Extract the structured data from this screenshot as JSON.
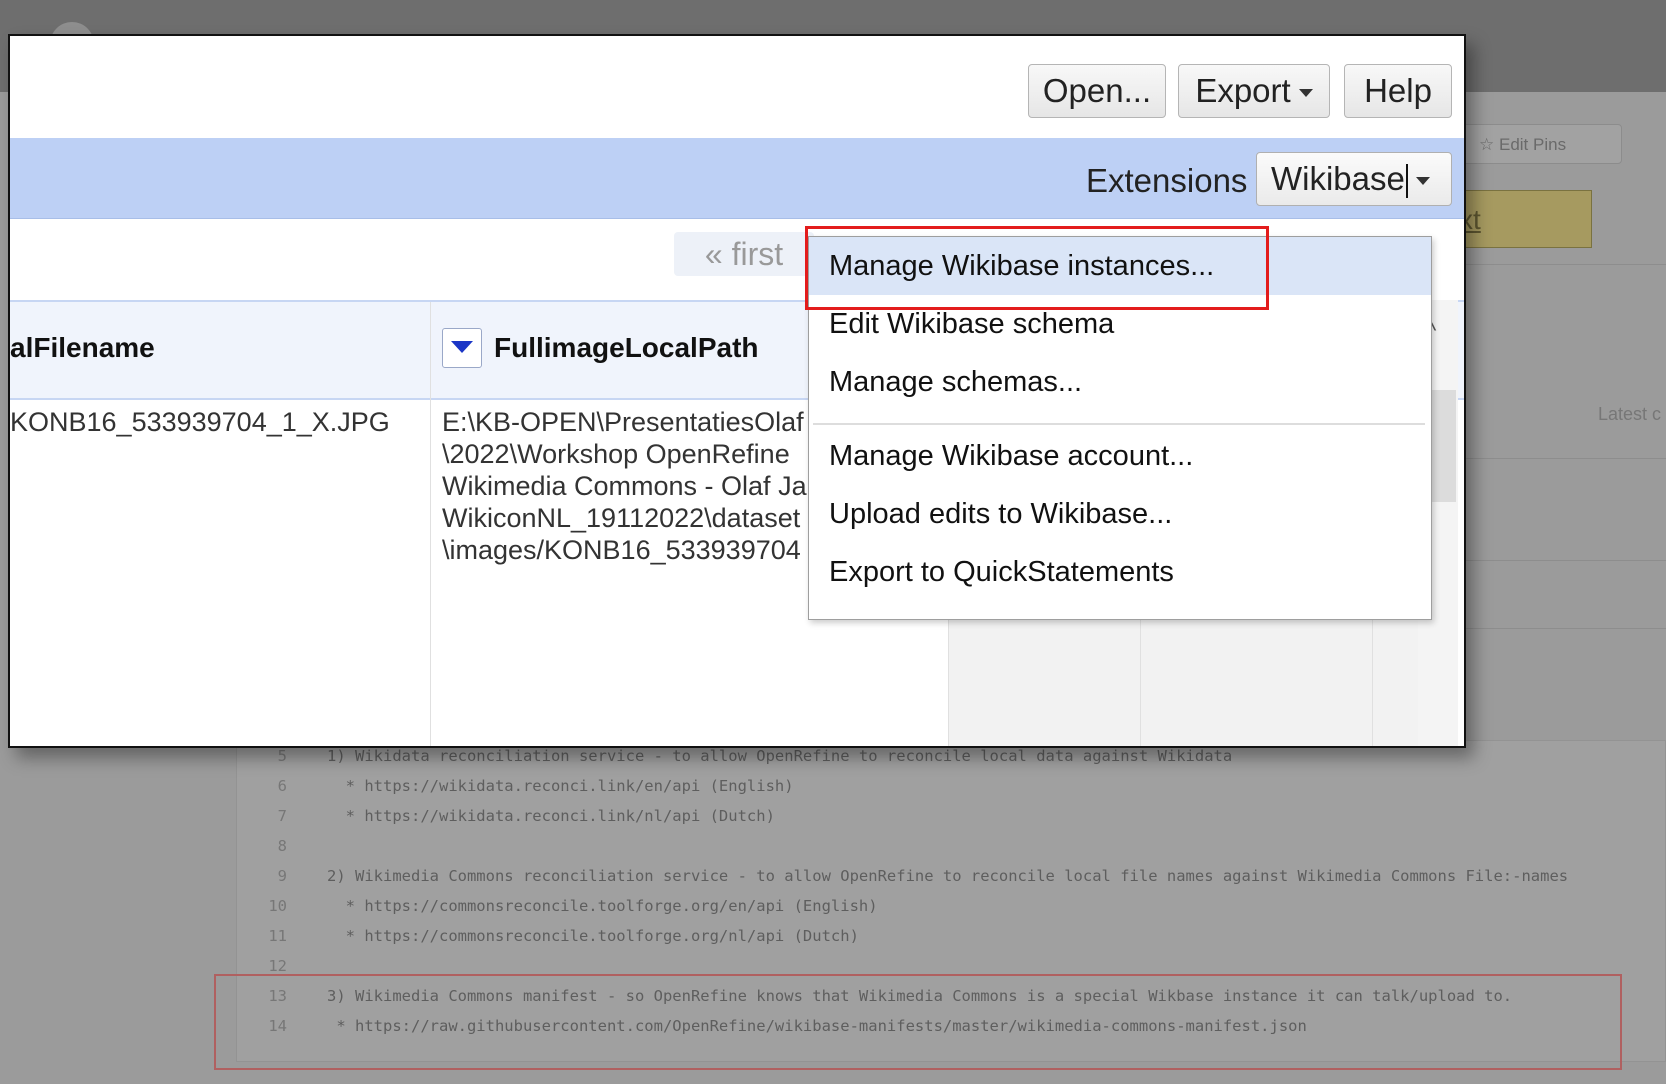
{
  "header": {
    "open_label": "Open...",
    "export_label": "Export",
    "help_label": "Help"
  },
  "extensions": {
    "label": "Extensions",
    "selected": "Wikibase"
  },
  "pager": {
    "first_label": "« first"
  },
  "table": {
    "columns": [
      {
        "title": "alFilename"
      },
      {
        "title": "FullimageLocalPath"
      }
    ],
    "row": {
      "cell1": "KONB16_533939704_1_X.JPG",
      "cell2": "E:\\KB-OPEN\\PresentatiesOlaf\n\\2022\\Workshop OpenRefine\nWikimedia Commons - Olaf Ja\nWikiconNL_19112022\\dataset\n\\images/KONB16_533939704"
    }
  },
  "menu": {
    "items": [
      {
        "label": "Manage Wikibase instances...",
        "active": true
      },
      {
        "label": "Edit Wikibase schema"
      },
      {
        "label": "Manage schemas..."
      },
      {
        "label": "Manage Wikibase account..."
      },
      {
        "label": "Upload edits to Wikibase..."
      },
      {
        "label": "Export to QuickStatements"
      }
    ]
  },
  "background": {
    "edit_pins": "Edit Pins",
    "next_fragment": "xt",
    "latest_fragment": "Latest c",
    "code_lines": [
      {
        "num": "5",
        "text": "1) Wikidata reconciliation service - to allow OpenRefine to reconcile local data against Wikidata"
      },
      {
        "num": "6",
        "text": "  * https://wikidata.reconci.link/en/api (English)"
      },
      {
        "num": "7",
        "text": "  * https://wikidata.reconci.link/nl/api (Dutch)"
      },
      {
        "num": "8",
        "text": ""
      },
      {
        "num": "9",
        "text": "2) Wikimedia Commons reconciliation service - to allow OpenRefine to reconcile local file names against Wikimedia Commons File:-names"
      },
      {
        "num": "10",
        "text": "  * https://commonsreconcile.toolforge.org/en/api (English)"
      },
      {
        "num": "11",
        "text": "  * https://commonsreconcile.toolforge.org/nl/api (Dutch)"
      },
      {
        "num": "12",
        "text": ""
      },
      {
        "num": "13",
        "text": "3) Wikimedia Commons manifest - so OpenRefine knows that Wikimedia Commons is a special Wikbase instance it can talk/upload to."
      },
      {
        "num": "14",
        "text": " * https://raw.githubusercontent.com/OpenRefine/wikibase-manifests/master/wikimedia-commons-manifest.json"
      }
    ]
  },
  "colors": {
    "highlight": "#e31c1c",
    "ext_bar": "#bdd0f5",
    "menu_active": "#dae5f7"
  }
}
